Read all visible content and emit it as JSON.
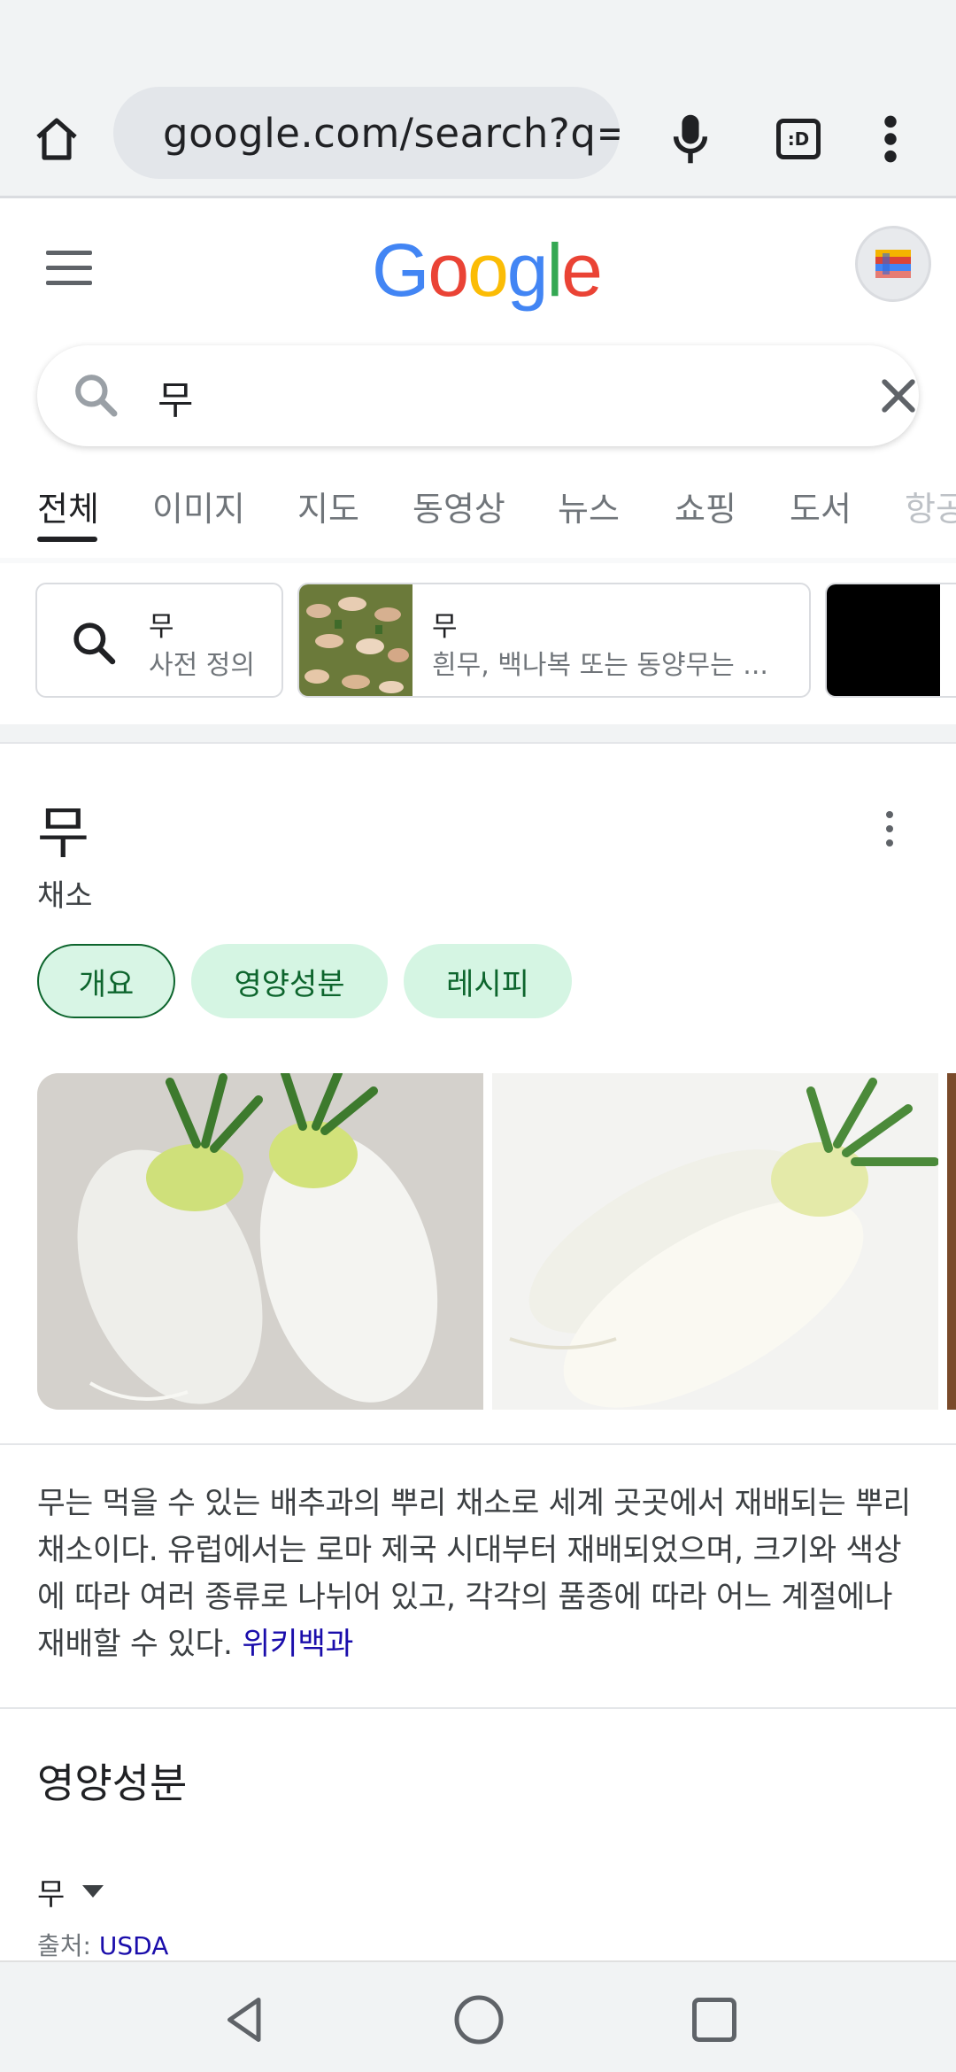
{
  "browser": {
    "url": "google.com/search?q="
  },
  "google": {
    "logo": [
      "G",
      "o",
      "o",
      "g",
      "l",
      "e"
    ],
    "logo_colors": [
      "#4285F4",
      "#EA4335",
      "#FBBC05",
      "#4285F4",
      "#34A853",
      "#EA4335"
    ]
  },
  "search": {
    "query": "무"
  },
  "tabs": [
    "전체",
    "이미지",
    "지도",
    "동영상",
    "뉴스",
    "쇼핑",
    "도서",
    "항공"
  ],
  "chips": [
    {
      "title": "무",
      "subtitle": "사전 정의"
    },
    {
      "title": "무",
      "subtitle": "흰무, 백나복 또는 동양무는 ..."
    }
  ],
  "panel": {
    "title": "무",
    "subtitle": "채소",
    "pills": [
      "개요",
      "영양성분",
      "레시피"
    ],
    "description": "무는 먹을 수 있는 배추과의 뿌리 채소로 세계 곳곳에서 재배되는 뿌리 채소이다. 유럽에서는 로마 제국 시대부터 재배되었으며, 크기와 색상에 따라 여러 종류로 나뉘어 있고, 각각의 품종에 따라 어느 계절에나 재배할 수 있다.",
    "source_link": "위키백과"
  },
  "nutrition": {
    "title": "영양성분",
    "item": "무",
    "source_label": "출처:",
    "source_link": "USDA"
  },
  "colors": {
    "pill_bg": "#D5F5E3",
    "pill_text": "#0D652D",
    "link": "#1A0DAB"
  }
}
